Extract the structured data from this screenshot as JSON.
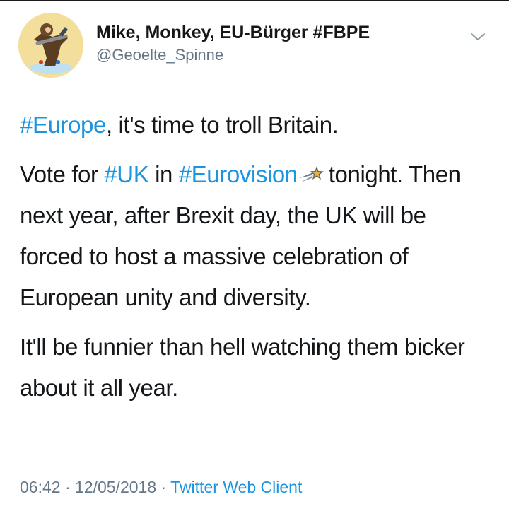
{
  "user": {
    "display_name": "Mike, Monkey, EU-Bürger #FBPE",
    "handle": "@Geoelte_Spinne"
  },
  "tweet": {
    "p1": {
      "tag": "#Europe",
      "text": ", it's time to troll Britain."
    },
    "p2": {
      "t1": "Vote for ",
      "tag1": "#UK",
      "t2": " in ",
      "tag2": "#Eurovision",
      "t3": "tonight.",
      "t4": "Then next year, after Brexit day, the UK will be forced to host a massive celebration of European unity and diversity."
    },
    "p3": "It'll be funnier than hell watching them bicker about it all year."
  },
  "meta": {
    "time": "06:42",
    "sep": " · ",
    "date": "12/05/2018",
    "source": "Twitter Web Client"
  },
  "colors": {
    "link": "#1b95e0",
    "muted": "#657786",
    "text": "#14171a"
  },
  "icons": {
    "menu": "chevron-down-icon",
    "eurovision": "shooting-star-icon"
  }
}
